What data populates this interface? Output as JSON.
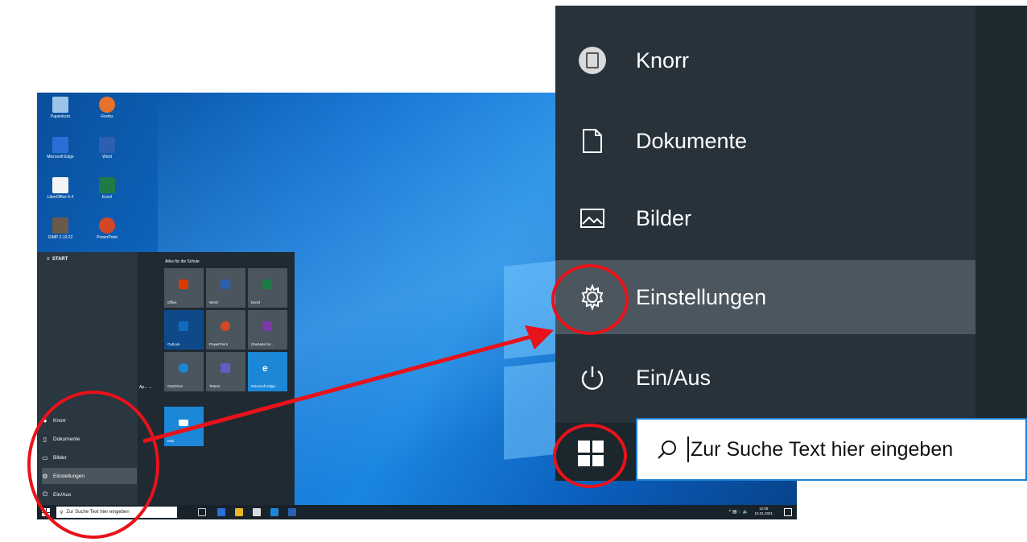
{
  "desktop": {
    "icons": [
      {
        "label": "Papierkorb",
        "color": "#9cc4e8"
      },
      {
        "label": "Firefox",
        "color": "#e8722a"
      },
      {
        "label": "Microsoft Edge",
        "color": "#2b6fd6"
      },
      {
        "label": "Word",
        "color": "#2b5fb0"
      },
      {
        "label": "LibreOffice 6.4",
        "color": "#f4f4f4"
      },
      {
        "label": "Excel",
        "color": "#1e7b45"
      },
      {
        "label": "GIMP 2.10.22",
        "color": "#6a5a4a"
      },
      {
        "label": "PowerPoint",
        "color": "#d24726"
      }
    ]
  },
  "start_menu": {
    "header": "START",
    "group_title": "Alles für die Schule",
    "app_fragment": "Ap... ⌄",
    "items": [
      {
        "label": "Knorr",
        "icon": "user-icon"
      },
      {
        "label": "Dokumente",
        "icon": "document-icon"
      },
      {
        "label": "Bilder",
        "icon": "pictures-icon"
      },
      {
        "label": "Einstellungen",
        "icon": "gear-icon"
      },
      {
        "label": "Ein/Aus",
        "icon": "power-icon"
      }
    ],
    "tiles": [
      {
        "label": "Office",
        "bg": "#4a555d",
        "glyph": "#d83b01"
      },
      {
        "label": "Word",
        "bg": "#4a555d",
        "glyph": "#2b5fb0"
      },
      {
        "label": "Excel",
        "bg": "#4a555d",
        "glyph": "#1e7b45"
      },
      {
        "label": "Outlook",
        "bg": "#0e4a8a",
        "glyph": "#0f6cbd"
      },
      {
        "label": "PowerPoint",
        "bg": "#4a555d",
        "glyph": "#d24726"
      },
      {
        "label": "OneNote for...",
        "bg": "#4a555d",
        "glyph": "#7b3aa8"
      },
      {
        "label": "OneDrive",
        "bg": "#4a555d",
        "glyph": "#1b87d6"
      },
      {
        "label": "Teams",
        "bg": "#4a555d",
        "glyph": "#5b5fc7"
      },
      {
        "label": "Microsoft Edge",
        "bg": "#1b87d6",
        "glyph": "#ffffff"
      },
      {
        "label": "Mail",
        "bg": "#1b87d6",
        "glyph": "#ffffff"
      }
    ]
  },
  "taskbar": {
    "search_placeholder": "Zur Suche Text hier eingeben",
    "clock_time": "12:08",
    "clock_date": "10.01.2021"
  },
  "zoom_panel": {
    "items": [
      {
        "label": "Knorr",
        "icon": "user-icon"
      },
      {
        "label": "Dokumente",
        "icon": "document-icon"
      },
      {
        "label": "Bilder",
        "icon": "pictures-icon"
      },
      {
        "label": "Einstellungen",
        "icon": "gear-icon"
      },
      {
        "label": "Ein/Aus",
        "icon": "power-icon"
      }
    ],
    "search_placeholder": "Zur Suche Text hier eingeben"
  },
  "colors": {
    "accent": "#1e7fd6",
    "annotation": "#e8121a",
    "menu_bg": "#27323a",
    "selected": "#4b565e"
  }
}
